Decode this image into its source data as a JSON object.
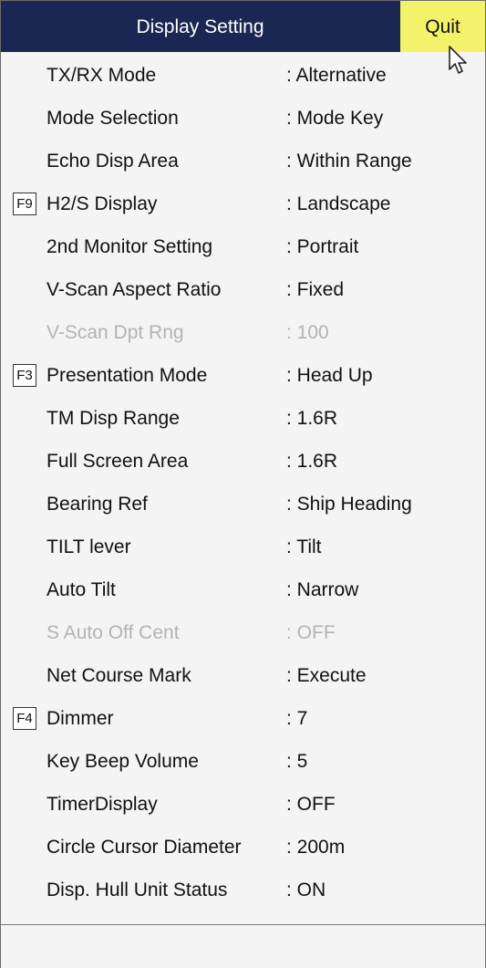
{
  "window": {
    "title": "Display Setting",
    "quit_label": "Quit"
  },
  "colors": {
    "header_bg": "#1c2652",
    "quit_bg": "#f4f26a",
    "disabled_text": "#b3b3b3"
  },
  "rows": [
    {
      "label": "TX/RX Mode",
      "value": ": Alternative",
      "fkey": "",
      "disabled": false
    },
    {
      "label": "Mode Selection",
      "value": ": Mode Key",
      "fkey": "",
      "disabled": false
    },
    {
      "label": "Echo Disp Area",
      "value": ": Within Range",
      "fkey": "",
      "disabled": false
    },
    {
      "label": "H2/S Display",
      "value": ": Landscape",
      "fkey": "F9",
      "disabled": false
    },
    {
      "label": "2nd Monitor Setting",
      "value": ": Portrait",
      "fkey": "",
      "disabled": false
    },
    {
      "label": "V-Scan Aspect Ratio",
      "value": ": Fixed",
      "fkey": "",
      "disabled": false
    },
    {
      "label": "V-Scan Dpt Rng",
      "value": ": 100",
      "fkey": "",
      "disabled": true
    },
    {
      "label": "Presentation Mode",
      "value": ": Head Up",
      "fkey": "F3",
      "disabled": false
    },
    {
      "label": "TM Disp Range",
      "value": ": 1.6R",
      "fkey": "",
      "disabled": false
    },
    {
      "label": "Full Screen Area",
      "value": ": 1.6R",
      "fkey": "",
      "disabled": false
    },
    {
      "label": "Bearing Ref",
      "value": ": Ship Heading",
      "fkey": "",
      "disabled": false
    },
    {
      "label": "TILT lever",
      "value": ": Tilt",
      "fkey": "",
      "disabled": false
    },
    {
      "label": "Auto Tilt",
      "value": ": Narrow",
      "fkey": "",
      "disabled": false
    },
    {
      "label": "S Auto Off Cent",
      "value": ": OFF",
      "fkey": "",
      "disabled": true
    },
    {
      "label": "Net Course Mark",
      "value": ": Execute",
      "fkey": "",
      "disabled": false
    },
    {
      "label": "Dimmer",
      "value": ": 7",
      "fkey": "F4",
      "disabled": false
    },
    {
      "label": "Key Beep Volume",
      "value": ": 5",
      "fkey": "",
      "disabled": false
    },
    {
      "label": "TimerDisplay",
      "value": ": OFF",
      "fkey": "",
      "disabled": false
    },
    {
      "label": "Circle Cursor Diameter",
      "value": ": 200m",
      "fkey": "",
      "disabled": false
    },
    {
      "label": "Disp. Hull Unit Status",
      "value": ": ON",
      "fkey": "",
      "disabled": false
    }
  ]
}
